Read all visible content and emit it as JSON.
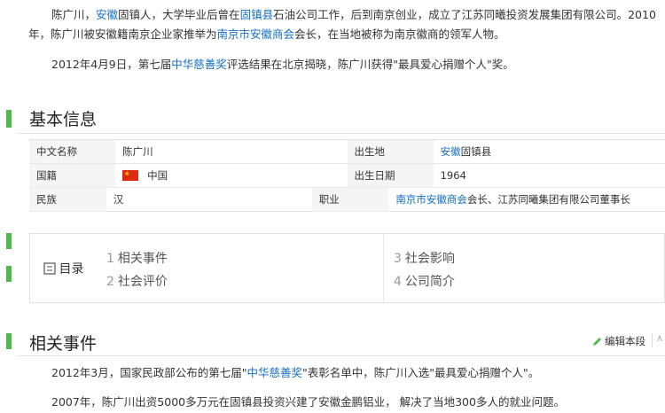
{
  "intro": {
    "name": "陈广川",
    "sep": "，",
    "province_link": "安徽",
    "t1": "固镇人，大学毕业后曾在",
    "county_link": "固镇县",
    "t2": "石油公司工作，后到南京创业，成立了江苏同曦投资发展集团有限公司。2010",
    "t3": "年，陈广川被安徽籍南京企业家推举为",
    "chamber_link": "南京市安徽商会",
    "t4": "会长，在当地被称为南京徽商的领军人物。",
    "award_pre": "2012年4月9日，第七届",
    "award_link": "中华慈善奖",
    "award_post": "评选结果在北京揭晓，陈广川获得\"最具爱心捐赠个人\"奖。"
  },
  "basic_info": {
    "title": "基本信息",
    "left": [
      {
        "label": "中文名称",
        "value": "陈广川"
      },
      {
        "label": "国籍",
        "value": "中国"
      },
      {
        "label": "民族",
        "value": "汉"
      }
    ],
    "right": {
      "birthplace_label": "出生地",
      "birthplace_link": "安徽",
      "birthplace_rest": "固镇县",
      "birthdate_label": "出生日期",
      "birthdate_value": "1964",
      "job_label": "职业",
      "job_link": "南京市安徽商会",
      "job_rest": "会长、江苏同曦集团有限公司董事长"
    }
  },
  "toc": {
    "title": "目录",
    "items": [
      {
        "num": "1",
        "label": "相关事件"
      },
      {
        "num": "2",
        "label": "社会评价"
      },
      {
        "num": "3",
        "label": "社会影响"
      },
      {
        "num": "4",
        "label": "公司简介"
      }
    ]
  },
  "events": {
    "title": "相关事件",
    "edit_label": "编辑本段",
    "p1_pre": "2012年3月，国家民政部公布的第七届\"",
    "p1_link": "中华慈善奖",
    "p1_post": "\"表彰名单中，陈广川入选\"最具爱心捐赠个人\"。",
    "p2": "2007年，陈广川出资5000多万元在固镇县投资兴建了安徽金鹏铝业， 解决了当地300多人的就业问题。"
  },
  "colors": {
    "accent_bar": "#4fb84b",
    "link": "#136ec2",
    "flag": "#de2910"
  }
}
